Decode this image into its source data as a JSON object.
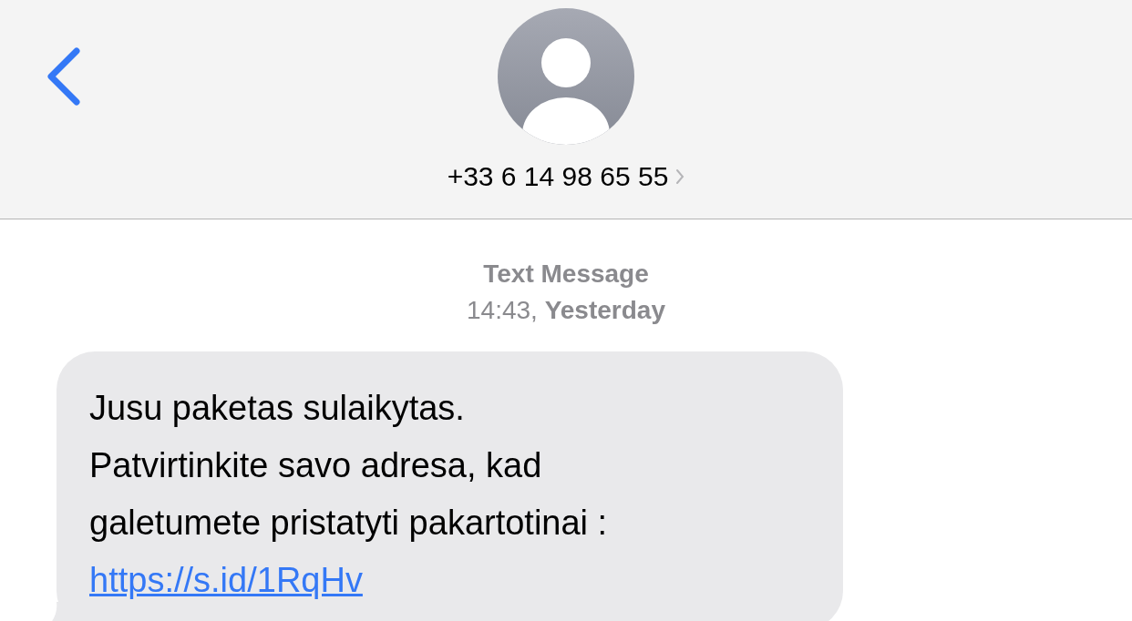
{
  "header": {
    "contact": "+33 6 14 98 65 55"
  },
  "thread": {
    "service": "Text Message",
    "timestamp": "14:43, **Yesterday**"
  },
  "messages": [
    {
      "kind": "received",
      "lines": [
        "Jusu paketas sulaikytas.",
        "Patvirtinkite savo adresa, kad",
        "galetumete pristatyti pakartotinai :"
      ],
      "link": "https://s.id/1RqHv"
    }
  ]
}
